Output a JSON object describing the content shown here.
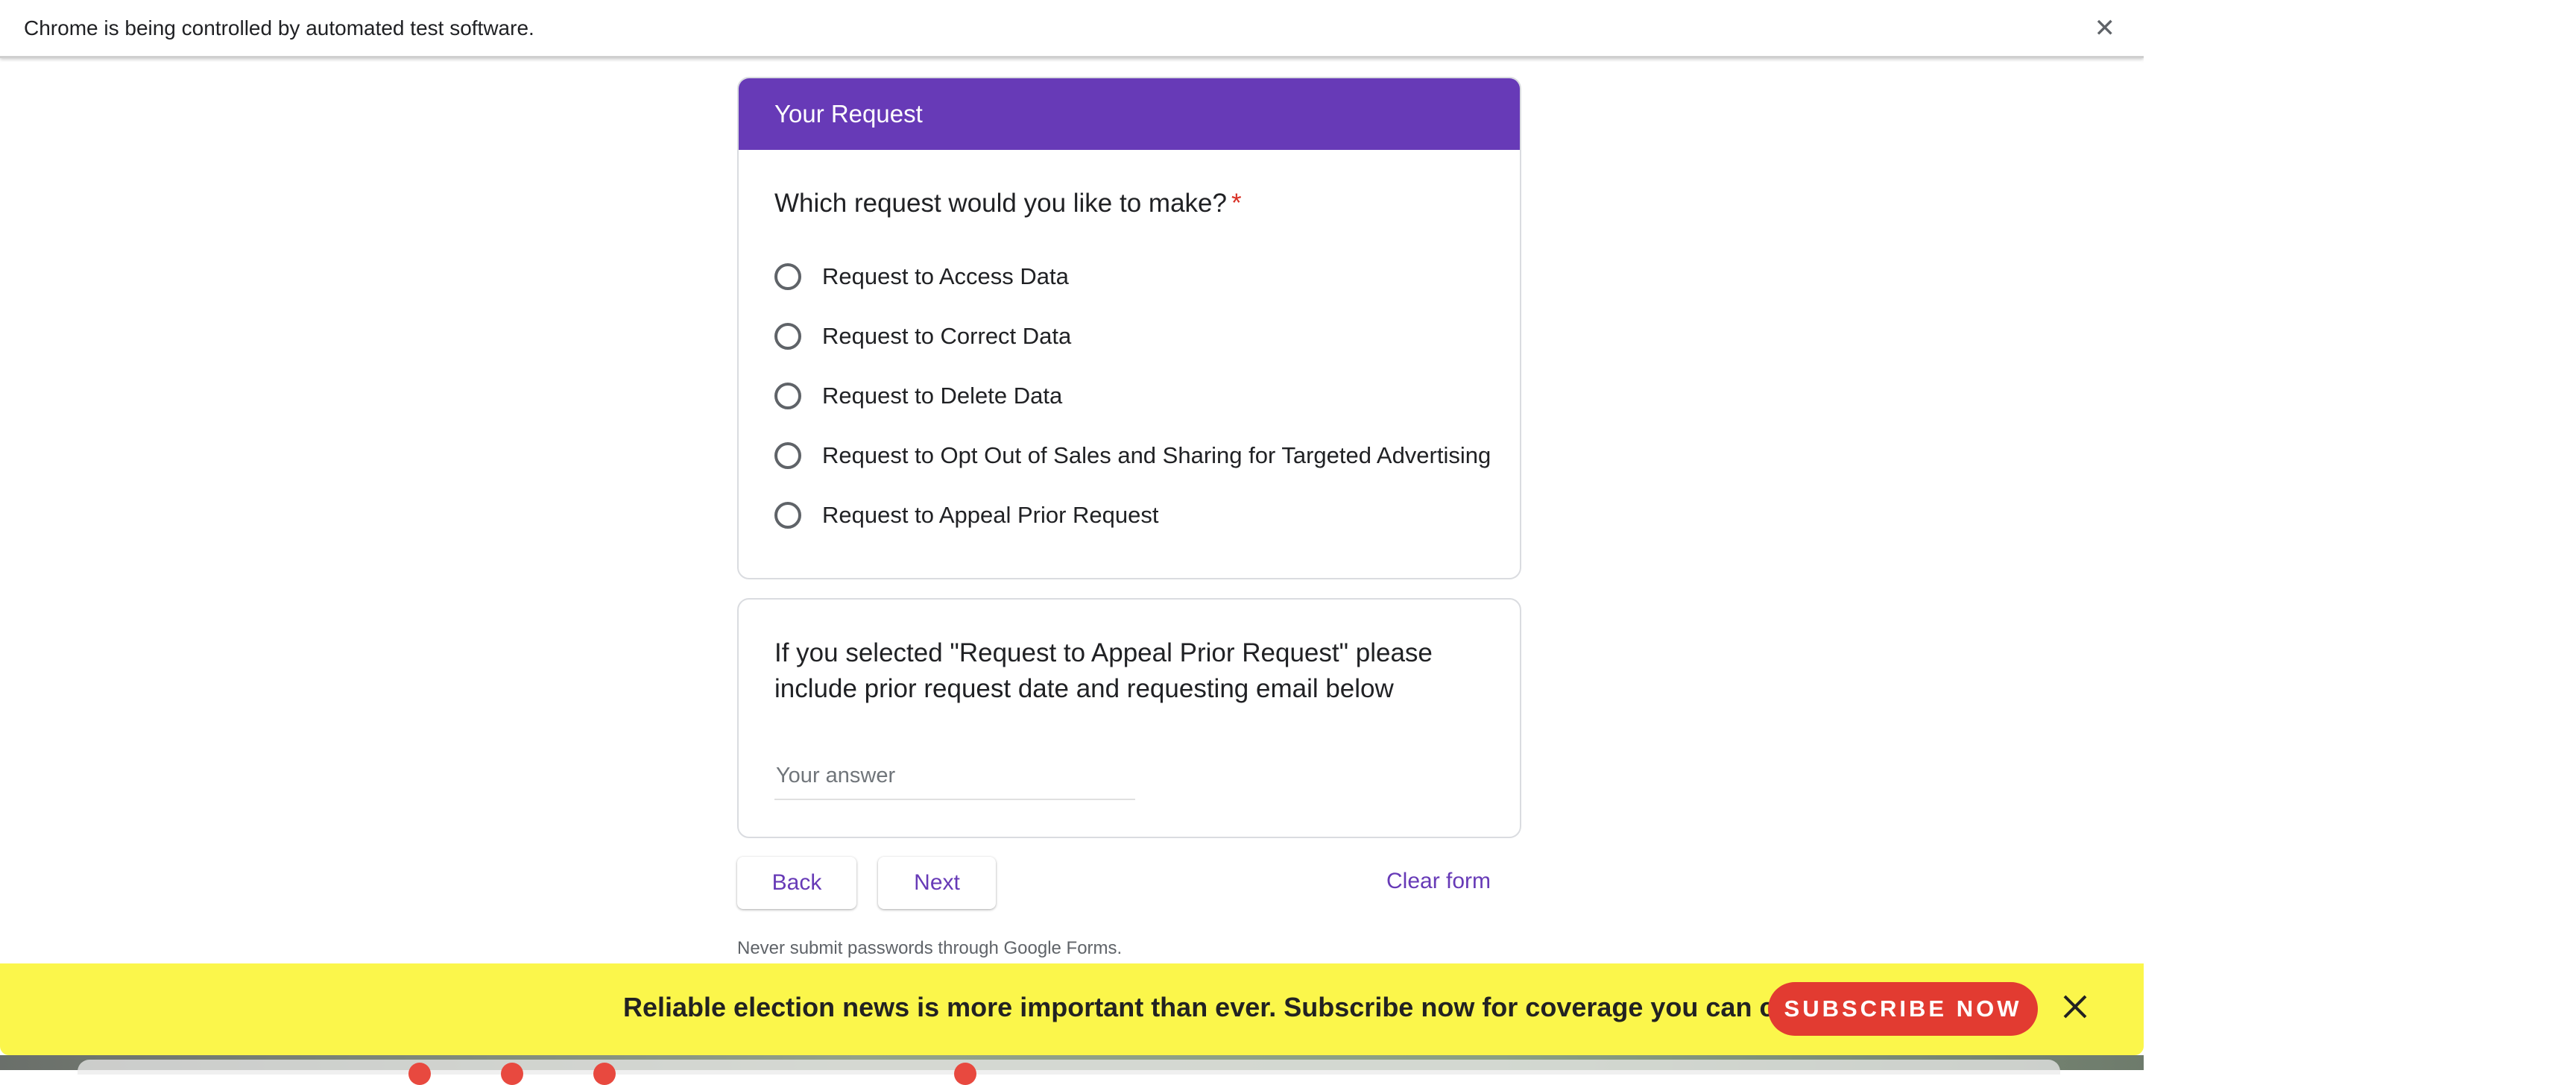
{
  "browser": {
    "automation_message": "Chrome is being controlled by automated test software.",
    "close_symbol": "✕"
  },
  "section": {
    "title": "Your Request",
    "header_color": "#673ab7"
  },
  "question1": {
    "text": "Which request would you like to make?",
    "required_marker": "*",
    "options": [
      {
        "label": "Request to Access Data",
        "selected": false
      },
      {
        "label": "Request to Correct Data",
        "selected": false
      },
      {
        "label": "Request to Delete Data",
        "selected": false
      },
      {
        "label": "Request to Opt Out of Sales and Sharing for Targeted Advertising",
        "selected": false
      },
      {
        "label": "Request to Appeal Prior Request",
        "selected": false
      }
    ]
  },
  "question2": {
    "text": "If you selected \"Request to Appeal Prior Request\" please include prior request date and requesting email below",
    "placeholder": "Your answer",
    "value": ""
  },
  "navigation": {
    "back_label": "Back",
    "next_label": "Next",
    "clear_label": "Clear form"
  },
  "footer": {
    "password_warning": "Never submit passwords through Google Forms."
  },
  "banner": {
    "text": "Reliable election news is more important than ever. Subscribe now for coverage you can count on.",
    "cta_label": "SUBSCRIBE NOW",
    "background": "#fbf64b",
    "cta_color": "#e23b31",
    "close_icon": "close-icon"
  }
}
